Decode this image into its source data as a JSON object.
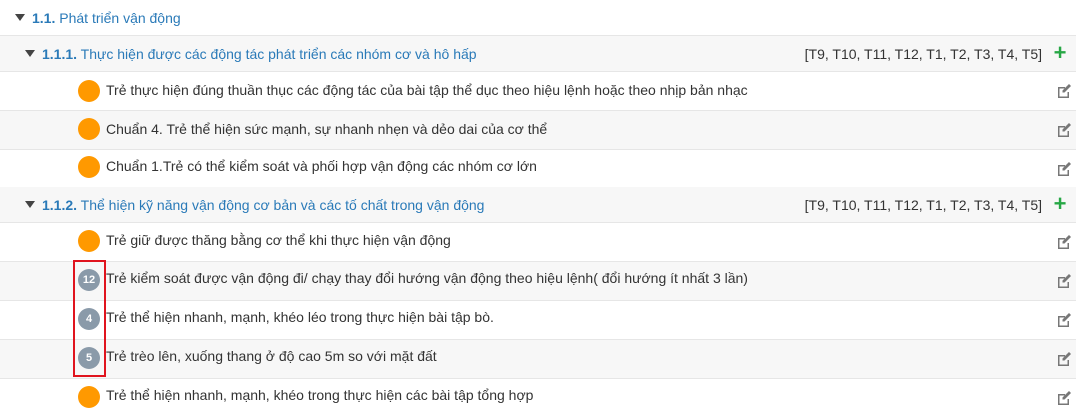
{
  "section": {
    "number": "1.1.",
    "title": "Phát triển vận động",
    "subsections": [
      {
        "number": "1.1.1.",
        "title": "Thực hiện được các động tác phát triển các nhóm cơ và hô hấp",
        "months": "[T9, T10, T11, T12, T1, T2, T3, T4, T5]",
        "items": [
          {
            "text": "Trẻ thực hiện đúng thuần thục các động tác của bài tập thể dục theo hiệu lệnh hoặc theo nhịp bản nhạc",
            "badge": ""
          },
          {
            "text": "Chuẩn 4. Trẻ thể hiện sức mạnh, sự nhanh nhẹn và dẻo dai của cơ thể",
            "badge": ""
          },
          {
            "text": "Chuẩn 1.Trẻ có thể kiểm soát và phối hợp vận động các nhóm cơ lớn",
            "badge": ""
          }
        ]
      },
      {
        "number": "1.1.2.",
        "title": "Thể hiện kỹ năng vận động cơ bản và các tố chất trong vận động",
        "months": "[T9, T10, T11, T12, T1, T2, T3, T4, T5]",
        "items": [
          {
            "text": "Trẻ giữ được thăng bằng cơ thể khi thực hiện vận động",
            "badge": ""
          },
          {
            "text": "Trẻ kiểm soát được vận động đi/ chạy thay đổi hướng vận động theo hiệu lệnh( đổi hướng ít nhất 3 lần)",
            "badge": "12"
          },
          {
            "text": "Trẻ thể hiện nhanh, mạnh, khéo léo trong thực hiện bài tập bò.",
            "badge": "4"
          },
          {
            "text": "Trẻ trèo lên, xuống thang ở độ cao 5m so với mặt đất",
            "badge": "5"
          },
          {
            "text": "Trẻ thể hiện nhanh, mạnh, khéo trong thực hiện các bài tập tổng hợp",
            "badge": ""
          }
        ]
      }
    ]
  },
  "colors": {
    "link": "#2a7ab8",
    "orange_dot": "#ff9900",
    "badge": "#8a9aa9",
    "plus": "#27a745",
    "highlight": "#e0141e"
  },
  "icons": {
    "collapse": "caret-down-icon",
    "add": "plus-icon",
    "edit": "edit-icon"
  }
}
